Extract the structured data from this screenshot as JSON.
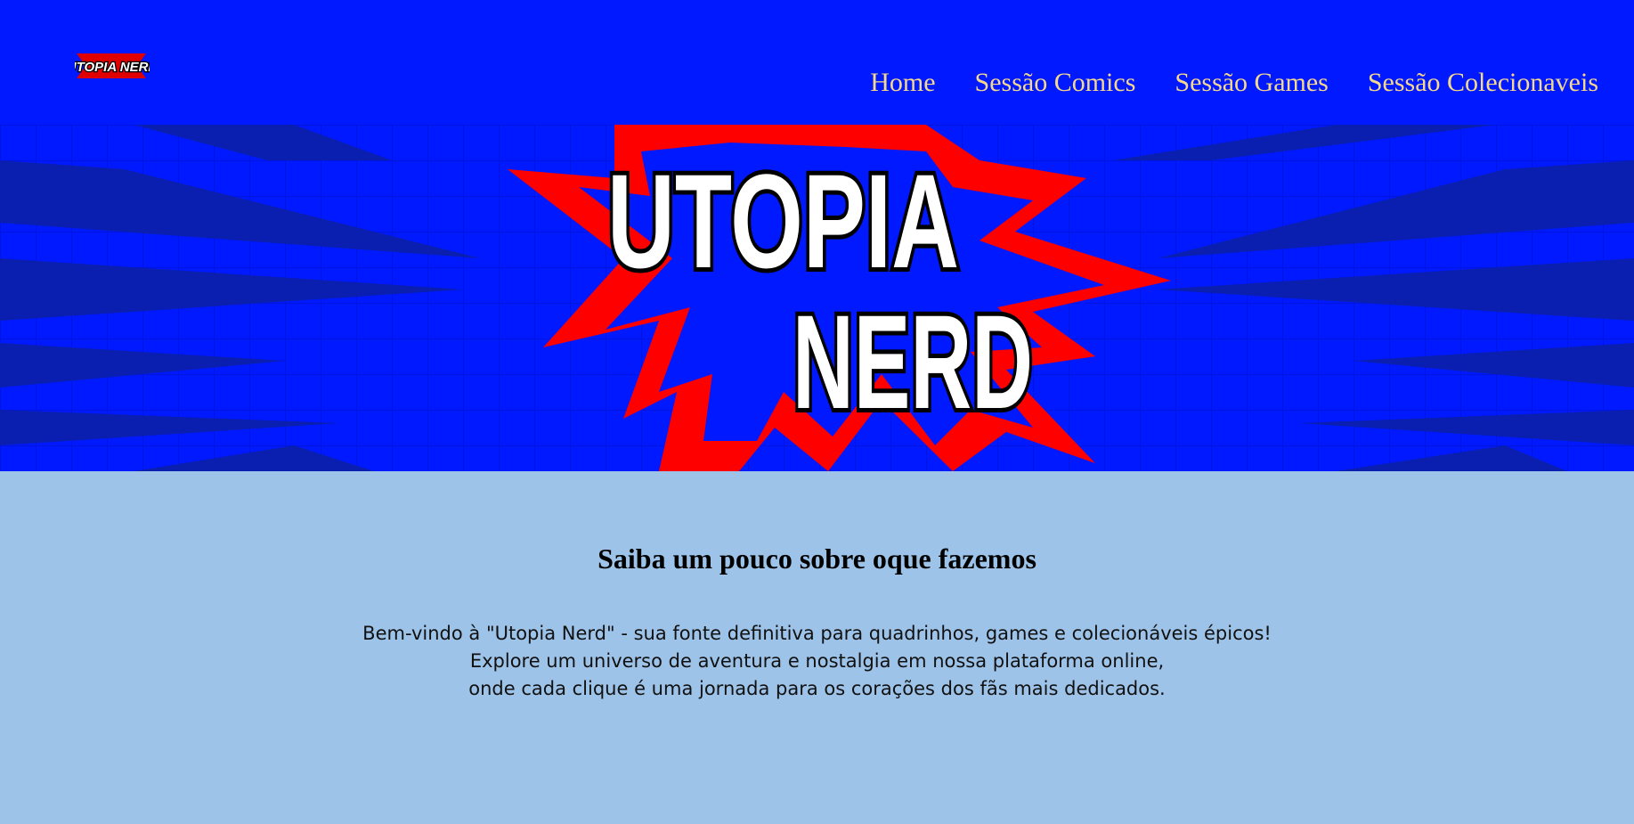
{
  "brand": {
    "logo_text": "UTOPIA NERD",
    "banner_line1": "UTOPIA",
    "banner_line2": "NERD"
  },
  "nav": {
    "items": [
      {
        "label": "Home"
      },
      {
        "label": "Sessão Comics"
      },
      {
        "label": "Sessão Games"
      },
      {
        "label": "Sessão Colecionaveis"
      }
    ]
  },
  "about": {
    "title": "Saiba um pouco sobre oque fazemos",
    "lines": [
      "Bem-vindo à \"Utopia Nerd\" - sua fonte definitiva para quadrinhos, games e colecionáveis épicos!",
      "Explore um universo de aventura e nostalgia em nossa plataforma online,",
      "onde cada clique é uma jornada para os corações dos fãs mais dedicados."
    ]
  },
  "colors": {
    "header_bg": "#0019ff",
    "nav_text": "#f5d88a",
    "section_bg": "#9dc3e9",
    "burst_red": "#ff0000",
    "ray_dark": "#0a1fb0"
  }
}
